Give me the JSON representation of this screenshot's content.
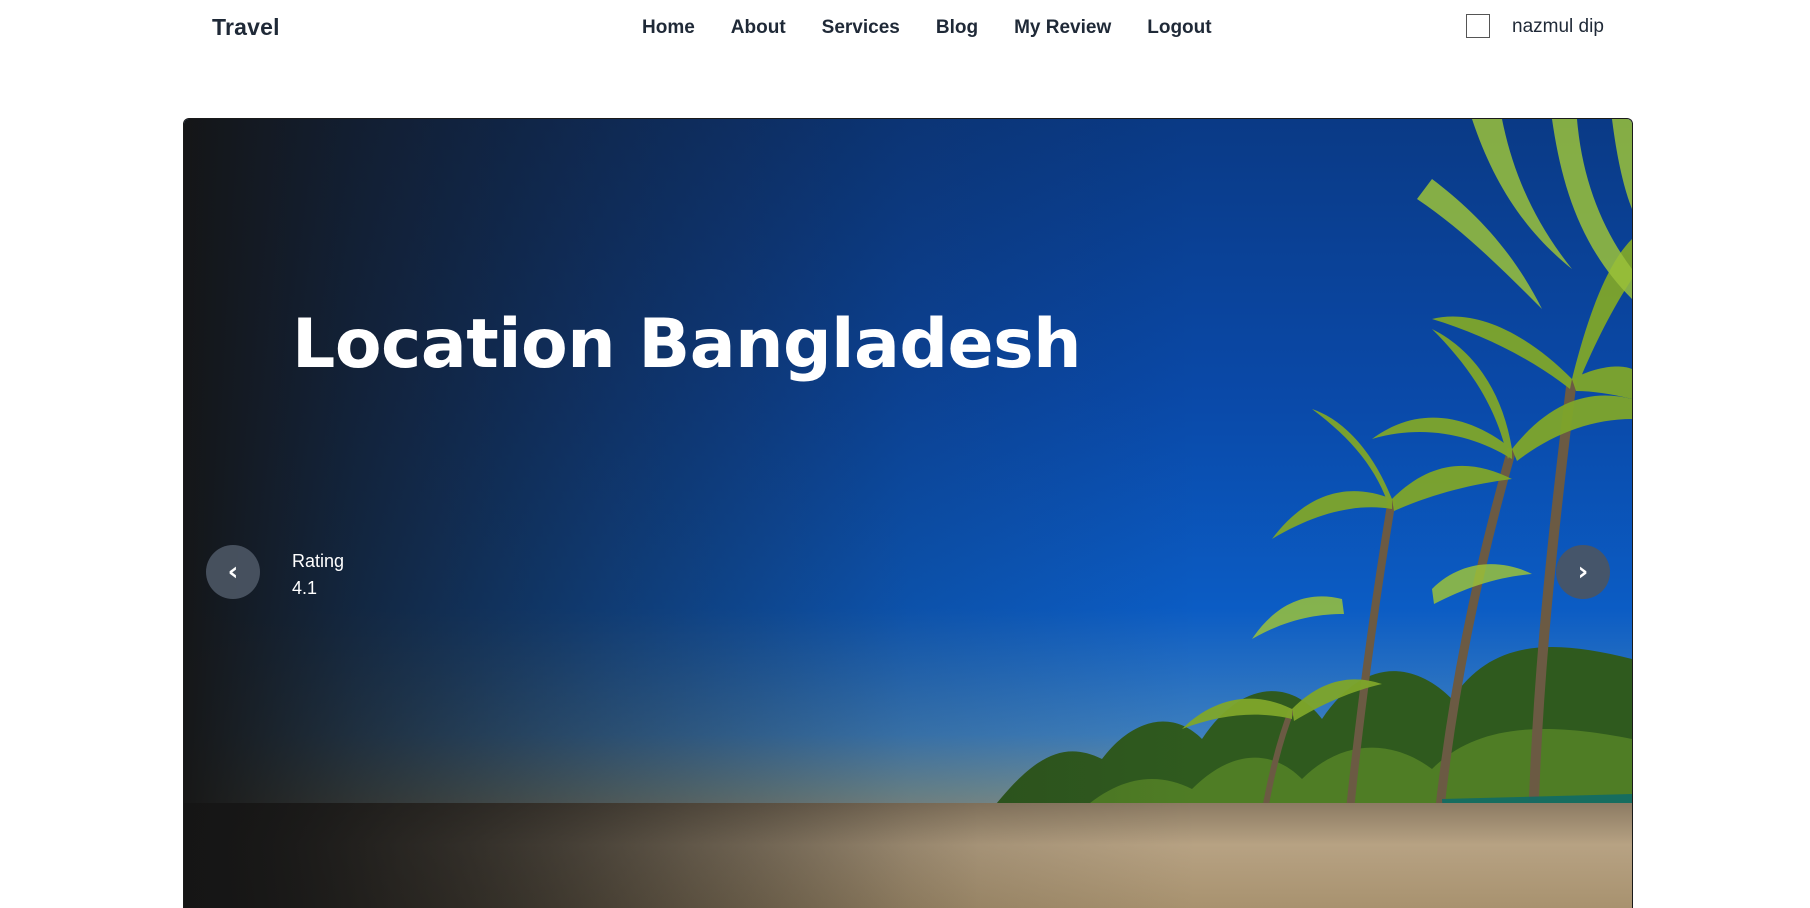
{
  "navbar": {
    "brand": "Travel",
    "menu": [
      {
        "label": "Home"
      },
      {
        "label": "About"
      },
      {
        "label": "Services"
      },
      {
        "label": "Blog"
      },
      {
        "label": "My Review"
      },
      {
        "label": "Logout"
      }
    ],
    "user_name": "nazmul dip"
  },
  "hero": {
    "title": "Location Bangladesh",
    "rating_label": "Rating",
    "rating_value": "4.1",
    "prev_label": "‹",
    "next_label": "›",
    "image_description_icon": "beach-palm-trees-image"
  }
}
